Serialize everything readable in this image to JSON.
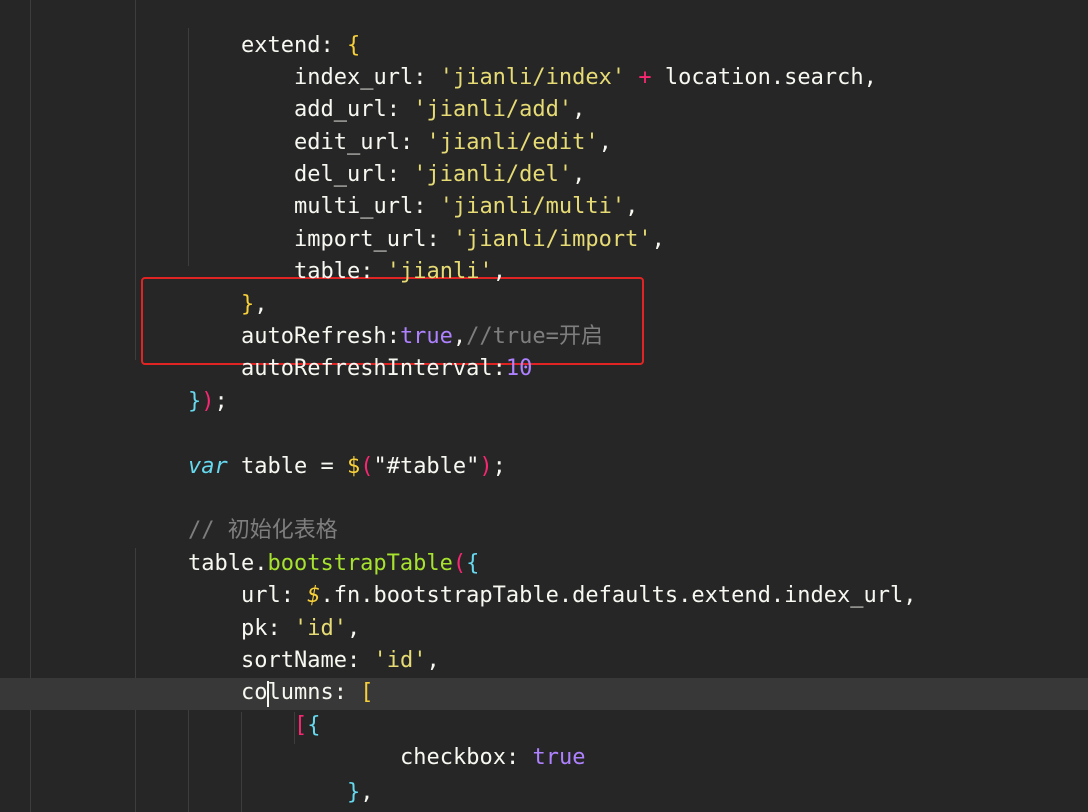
{
  "code": {
    "l0": {
      "key": "extend",
      "colon": ": ",
      "open": "{"
    },
    "l1": {
      "key": "index_url",
      "colon": ": ",
      "str": "'jianli/index'",
      "op": " + ",
      "rest": "location.search,"
    },
    "l2": {
      "key": "add_url",
      "colon": ": ",
      "str": "'jianli/add'",
      "rest": ","
    },
    "l3": {
      "key": "edit_url",
      "colon": ": ",
      "str": "'jianli/edit'",
      "rest": ","
    },
    "l4": {
      "key": "del_url",
      "colon": ": ",
      "str": "'jianli/del'",
      "rest": ","
    },
    "l5": {
      "key": "multi_url",
      "colon": ": ",
      "str": "'jianli/multi'",
      "rest": ","
    },
    "l6": {
      "key": "import_url",
      "colon": ": ",
      "str": "'jianli/import'",
      "rest": ","
    },
    "l7": {
      "key": "table",
      "colon": ": ",
      "str": "'jianli'",
      "rest": ","
    },
    "l8": {
      "close": "}",
      "rest": ","
    },
    "l9": {
      "key": "autoRefresh",
      "colon": ":",
      "val": "true",
      "comma": ",",
      "comment": "//true=开启"
    },
    "l10": {
      "key": "autoRefreshInterval",
      "colon": ":",
      "val": "10"
    },
    "l11": {
      "close": "}",
      "close2": ")",
      "rest": ";"
    },
    "l13": {
      "kw": "var",
      "name": " table = ",
      "dollar": "$",
      "open": "(",
      "str": "\"#table\"",
      "close": ")",
      "rest": ";"
    },
    "l15": {
      "comment": "// 初始化表格"
    },
    "l16": {
      "obj": "table.",
      "fn": "bootstrapTable",
      "open": "(",
      "open2": "{"
    },
    "l17": {
      "key": "url",
      "colon": ": ",
      "dollar": "$",
      "rest": ".fn.bootstrapTable.defaults.extend.index_url,"
    },
    "l18": {
      "key": "pk",
      "colon": ": ",
      "str": "'id'",
      "rest": ","
    },
    "l19": {
      "key": "sortName",
      "colon": ": ",
      "str": "'id'",
      "rest": ","
    },
    "l20": {
      "key": "columns",
      "colon": ": ",
      "open": "["
    },
    "l21": {
      "open": "[",
      "open2": "{"
    },
    "l22": {
      "key": "checkbox",
      "colon": ": ",
      "val": "true"
    },
    "l23": {
      "close": "}",
      "rest": ","
    },
    "l24": {
      "open": "{"
    }
  },
  "colors": {
    "background": "#262626",
    "string": "#e6db74",
    "keyword": "#66d9ef",
    "constant": "#ae81ff",
    "function": "#a6e22e",
    "operator": "#f92672",
    "comment": "#7e7e7e",
    "highlight_box": "#e02424"
  }
}
